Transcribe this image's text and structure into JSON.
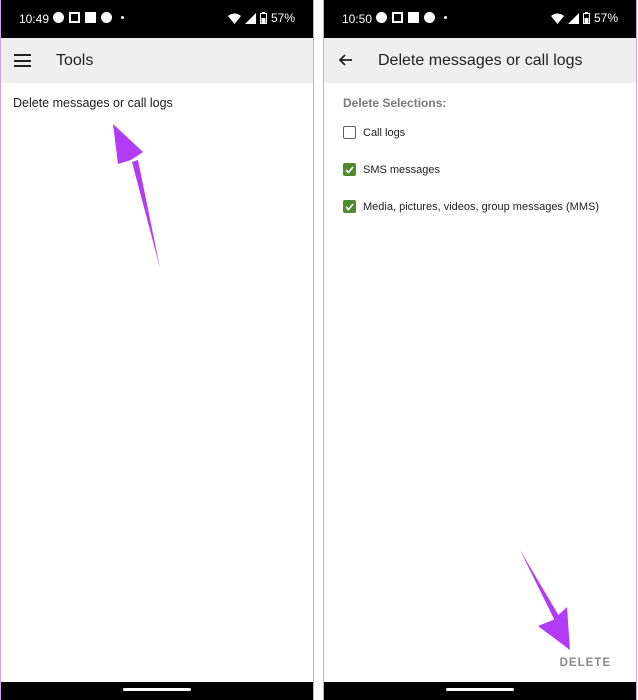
{
  "left_screen": {
    "status_bar": {
      "time": "10:49",
      "battery": "57%"
    },
    "app_bar": {
      "title": "Tools"
    },
    "items": [
      {
        "label": "Delete messages or call logs"
      }
    ]
  },
  "right_screen": {
    "status_bar": {
      "time": "10:50",
      "battery": "57%"
    },
    "app_bar": {
      "title": "Delete messages or call logs"
    },
    "section_title": "Delete Selections:",
    "options": [
      {
        "label": "Call logs",
        "checked": false
      },
      {
        "label": "SMS messages",
        "checked": true
      },
      {
        "label": "Media, pictures, videos, group messages (MMS)",
        "checked": true
      }
    ],
    "delete_label": "DELETE"
  },
  "colors": {
    "checkbox_checked": "#4f8a2e",
    "annotation_arrow": "#b23cf5"
  }
}
